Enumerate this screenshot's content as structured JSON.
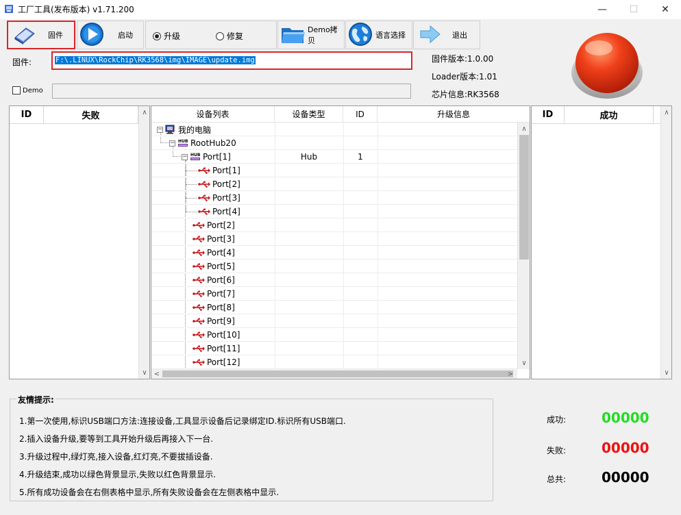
{
  "window": {
    "title": "工厂工具(发布版本) v1.71.200"
  },
  "toolbar": {
    "firmware_label": "固件",
    "start_label": "启动",
    "upgrade_label": "升级",
    "repair_label": "修复",
    "demo_copy_label": "Demo拷贝",
    "language_label": "语言选择",
    "exit_label": "退出"
  },
  "firmware": {
    "label": "固件:",
    "path": "F:\\.LINUX\\RockChip\\RK3568\\img\\IMAGE\\update.img"
  },
  "demo": {
    "label": "Demo"
  },
  "info": {
    "firmware_version": "固件版本:1.0.00",
    "loader_version": "Loader版本:1.01",
    "chip_info": "芯片信息:RK3568"
  },
  "fail_table": {
    "id_header": "ID",
    "title_header": "失败"
  },
  "success_table": {
    "id_header": "ID",
    "title_header": "成功"
  },
  "device_table": {
    "headers": [
      "设备列表",
      "设备类型",
      "ID",
      "升级信息"
    ],
    "rows": [
      {
        "name": "我的电脑",
        "type": "",
        "id": ""
      },
      {
        "name": "RootHub20",
        "type": "",
        "id": ""
      },
      {
        "name": "Port[1]",
        "type": "Hub",
        "id": "1"
      },
      {
        "name": "Port[1]",
        "type": "",
        "id": ""
      },
      {
        "name": "Port[2]",
        "type": "",
        "id": ""
      },
      {
        "name": "Port[3]",
        "type": "",
        "id": ""
      },
      {
        "name": "Port[4]",
        "type": "",
        "id": ""
      },
      {
        "name": "Port[2]",
        "type": "",
        "id": ""
      },
      {
        "name": "Port[3]",
        "type": "",
        "id": ""
      },
      {
        "name": "Port[4]",
        "type": "",
        "id": ""
      },
      {
        "name": "Port[5]",
        "type": "",
        "id": ""
      },
      {
        "name": "Port[6]",
        "type": "",
        "id": ""
      },
      {
        "name": "Port[7]",
        "type": "",
        "id": ""
      },
      {
        "name": "Port[8]",
        "type": "",
        "id": ""
      },
      {
        "name": "Port[9]",
        "type": "",
        "id": ""
      },
      {
        "name": "Port[10]",
        "type": "",
        "id": ""
      },
      {
        "name": "Port[11]",
        "type": "",
        "id": ""
      },
      {
        "name": "Port[12]",
        "type": "",
        "id": ""
      }
    ]
  },
  "tips": {
    "title": "友情提示:",
    "items": [
      "1.第一次使用,标识USB端口方法:连接设备,工具显示设备后记录绑定ID.标识所有USB端口.",
      "2.插入设备升级,要等到工具开始升级后再接入下一台.",
      "3.升级过程中,绿灯亮,接入设备,红灯亮,不要拔插设备.",
      "4.升级结束,成功以绿色背景显示,失败以红色背景显示.",
      "5.所有成功设备会在右侧表格中显示,所有失败设备会在左侧表格中显示."
    ]
  },
  "stats": {
    "success_label": "成功:",
    "success_value": "00000",
    "fail_label": "失败:",
    "fail_value": "00000",
    "total_label": "总共:",
    "total_value": "00000"
  },
  "colors": {
    "success": "#22dd22",
    "fail": "#ee1111",
    "total": "#000000",
    "highlight_border": "#d9252a",
    "selection": "#0078d7"
  }
}
